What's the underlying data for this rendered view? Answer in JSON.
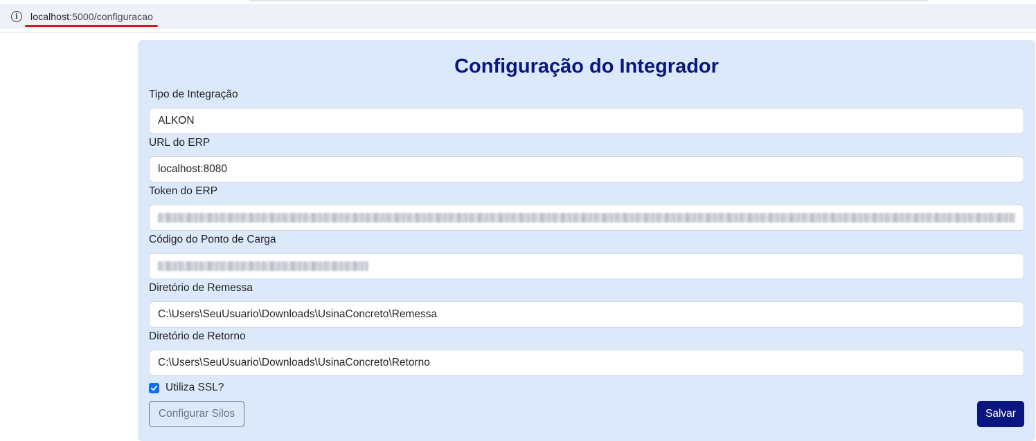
{
  "browser": {
    "url_host": "localhost",
    "url_rest": ":5000/configuracao"
  },
  "page": {
    "title": "Configuração do Integrador"
  },
  "form": {
    "tipo_label": "Tipo de Integração",
    "tipo_value": "ALKON",
    "url_label": "URL do ERP",
    "url_value": "localhost:8080",
    "token_label": "Token do ERP",
    "codigo_label": "Código do Ponto de Carga",
    "remessa_label": "Diretório de Remessa",
    "remessa_value": "C:\\Users\\SeuUsuario\\Downloads\\UsinaConcreto\\Remessa",
    "retorno_label": "Diretório de Retorno",
    "retorno_value": "C:\\Users\\SeuUsuario\\Downloads\\UsinaConcreto\\Retorno",
    "ssl_label": "Utiliza SSL?",
    "ssl_checked": true
  },
  "buttons": {
    "configurar_silos": "Configurar Silos",
    "salvar": "Salvar"
  },
  "colors": {
    "card_bg": "#dce9fb",
    "title": "#0a1580",
    "primary_button": "#0a1580",
    "checkbox": "#0d6efd",
    "url_underline": "#e0101a"
  }
}
